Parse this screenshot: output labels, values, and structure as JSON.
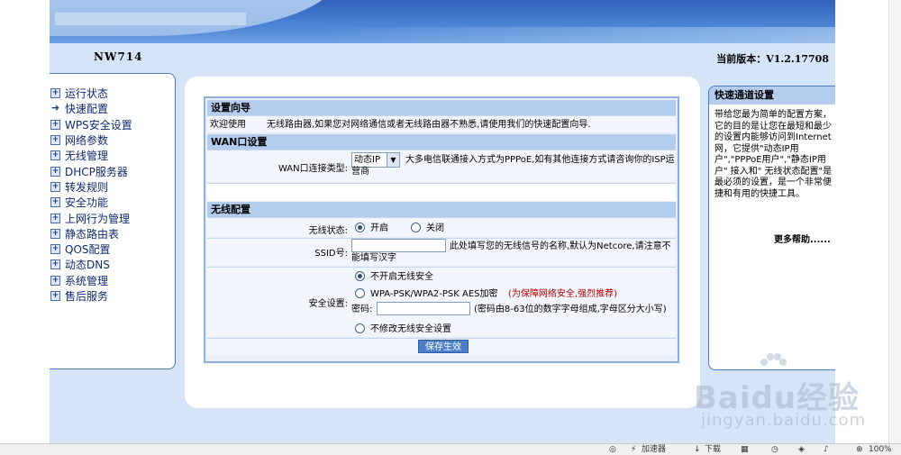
{
  "header": {
    "model": "NW714",
    "version": "当前版本：V1.2.17708"
  },
  "sidebar": {
    "items": [
      {
        "label": "运行状态",
        "icon": "plus-box-icon"
      },
      {
        "label": "快速配置",
        "icon": "arrow-right-icon",
        "active": true
      },
      {
        "label": "WPS安全设置",
        "icon": "plus-box-icon"
      },
      {
        "label": "网络参数",
        "icon": "plus-box-icon"
      },
      {
        "label": "无线管理",
        "icon": "plus-box-icon"
      },
      {
        "label": "DHCP服务器",
        "icon": "plus-box-icon"
      },
      {
        "label": "转发规则",
        "icon": "plus-box-icon"
      },
      {
        "label": "安全功能",
        "icon": "plus-box-icon"
      },
      {
        "label": "上网行为管理",
        "icon": "plus-box-icon"
      },
      {
        "label": "静态路由表",
        "icon": "plus-box-icon"
      },
      {
        "label": "QOS配置",
        "icon": "plus-box-icon"
      },
      {
        "label": "动态DNS",
        "icon": "plus-box-icon"
      },
      {
        "label": "系统管理",
        "icon": "plus-box-icon"
      },
      {
        "label": "售后服务",
        "icon": "plus-box-icon"
      }
    ]
  },
  "wizard": {
    "title": "设置向导",
    "welcome_label": "欢迎使用",
    "welcome_text": "无线路由器,如果您对网络通信或者无线路由器不熟悉,请使用我们的快速配置向导."
  },
  "wan": {
    "title": "WAN口设置",
    "type_label": "WAN口连接类型:",
    "type_value": "动态IP",
    "hint": "大多电信联通接入方式为PPPoE,如有其他连接方式请咨询你的ISP运营商"
  },
  "wireless": {
    "title": "无线配置",
    "status_label": "无线状态:",
    "status_on": "开启",
    "status_off": "关闭",
    "ssid_label": "SSID号:",
    "ssid_value": "",
    "ssid_hint": "此处填写您的无线信号的名称,默认为Netcore,请注意不能填写汉字",
    "security_label": "安全设置:",
    "sec_opt1": "不开启无线安全",
    "sec_opt2": "WPA-PSK/WPA2-PSK AES加密",
    "sec_opt2_hint": "(为保障网络安全,强烈推荐)",
    "password_label": "密码:",
    "password_value": "",
    "password_hint": "(密码由8-63位的数字字母组成,字母区分大小写)",
    "sec_opt3": "不修改无线安全设置",
    "save_label": "保存生效"
  },
  "help": {
    "title": "快速通道设置",
    "body": "带给您最为简单的配置方案，它的目的是让您在最短和最少的设置内能够访问到Internet网，它提供\"动态IP用户\",\"PPPoE用户\",\"静态IP用户\" 接入和\" 无线状态配置\"是最必须的设置，是一个非常便捷和有用的快捷工具。",
    "more": "更多帮助......"
  },
  "watermark": {
    "logo": "Baidu经验",
    "url": "jingyan.baidu.com"
  },
  "statusbar": {
    "accelerator": "加速器",
    "download": "下载",
    "zoom": "100%"
  },
  "colors": {
    "banner": "#3a6fc4",
    "background": "#d5e5f7",
    "section_header": "#b4cdee",
    "save_button": "#4c7fc8"
  }
}
